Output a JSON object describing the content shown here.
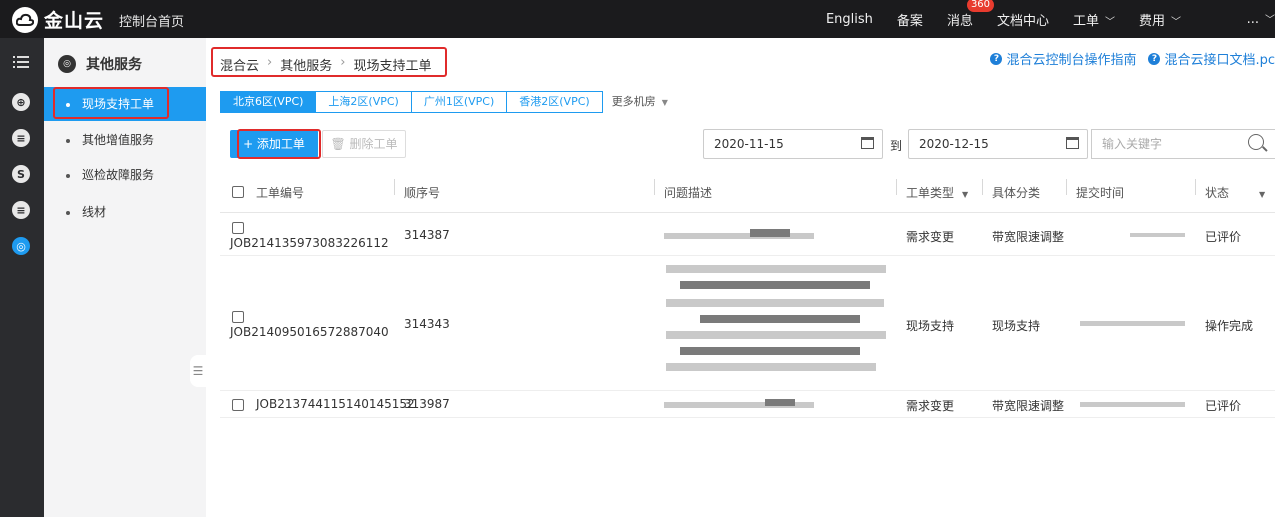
{
  "topbar": {
    "logo_text": "金山云",
    "console_home": "控制台首页",
    "nav": [
      {
        "label": "English"
      },
      {
        "label": "备案"
      },
      {
        "label": "消息",
        "badge": "360"
      },
      {
        "label": "文档中心"
      },
      {
        "label": "工单"
      },
      {
        "label": "费用"
      }
    ],
    "user_masked": "..."
  },
  "icon_rail": [
    "menu-icon",
    "globe-icon",
    "document-icon",
    "billing-icon",
    "document-icon",
    "service-icon"
  ],
  "sidebar": {
    "title": "其他服务",
    "items": [
      {
        "label": "现场支持工单",
        "active": true
      },
      {
        "label": "其他增值服务"
      },
      {
        "label": "巡检故障服务"
      },
      {
        "label": "线材"
      }
    ]
  },
  "breadcrumb": [
    "混合云",
    "其他服务",
    "现场支持工单"
  ],
  "help_links": [
    "混合云控制台操作指南",
    "混合云接口文档.pc"
  ],
  "region_tabs": [
    "北京6区(VPC)",
    "上海2区(VPC)",
    "广州1区(VPC)",
    "香港2区(VPC)"
  ],
  "more_regions": "更多机房",
  "toolbar": {
    "add_label": "+ 添加工单",
    "delete_label": "删除工单",
    "date_from": "2020-11-15",
    "to_label": "到",
    "date_to": "2020-12-15",
    "search_placeholder": "输入关键字"
  },
  "table": {
    "columns": [
      "工单编号",
      "顺序号",
      "问题描述",
      "工单类型",
      "具体分类",
      "提交时间",
      "状态"
    ],
    "rows": [
      {
        "id": "JOB214135973083226112",
        "seq": "314387",
        "type": "需求变更",
        "category": "带宽限速调整",
        "status": "已评价"
      },
      {
        "id": "JOB214095016572887040",
        "seq": "314343",
        "type": "现场支持",
        "category": "现场支持",
        "status": "操作完成"
      },
      {
        "id": "JOB213744115140145152",
        "seq": "313987",
        "type": "需求变更",
        "category": "带宽限速调整",
        "status": "已评价"
      }
    ]
  },
  "colors": {
    "accent": "#1e9bf0",
    "topbar": "#1b1b1d",
    "highlight": "#e02b2b"
  }
}
